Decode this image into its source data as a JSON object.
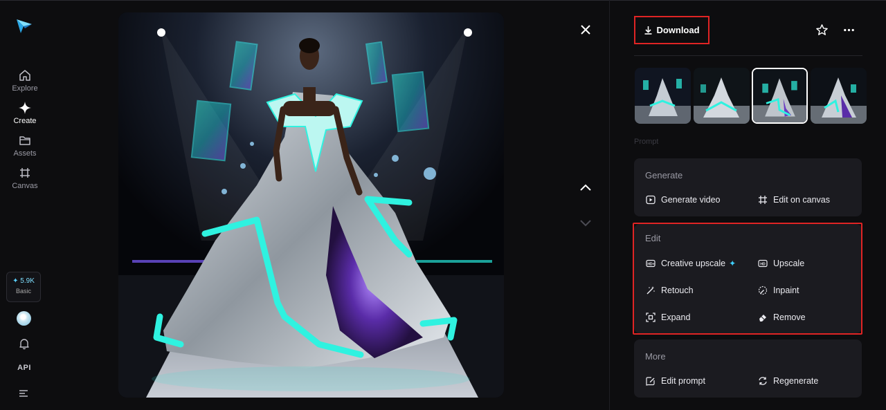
{
  "nav": {
    "items": [
      {
        "label": "Explore",
        "icon": "home-icon"
      },
      {
        "label": "Create",
        "icon": "sparkle-icon",
        "active": true
      },
      {
        "label": "Assets",
        "icon": "folder-icon"
      },
      {
        "label": "Canvas",
        "icon": "canvas-icon"
      }
    ],
    "credits": {
      "amount": "5.9K",
      "plan": "Basic"
    },
    "api_label": "API"
  },
  "panel": {
    "download_label": "Download",
    "prompt_label": "Prompt",
    "generate": {
      "title": "Generate",
      "actions": [
        {
          "label": "Generate video",
          "icon": "play-icon"
        },
        {
          "label": "Edit on canvas",
          "icon": "canvas-icon"
        }
      ]
    },
    "edit": {
      "title": "Edit",
      "actions": [
        {
          "label": "Creative upscale",
          "icon": "hd-plus-icon"
        },
        {
          "label": "Upscale",
          "icon": "hd-icon"
        },
        {
          "label": "Retouch",
          "icon": "magic-wand-icon"
        },
        {
          "label": "Inpaint",
          "icon": "brush-circle-icon"
        },
        {
          "label": "Expand",
          "icon": "expand-icon"
        },
        {
          "label": "Remove",
          "icon": "eraser-icon"
        }
      ]
    },
    "more": {
      "title": "More",
      "actions": [
        {
          "label": "Edit prompt",
          "icon": "edit-prompt-icon"
        },
        {
          "label": "Regenerate",
          "icon": "regenerate-icon"
        }
      ]
    }
  },
  "thumbnails": {
    "count": 4,
    "selected_index": 2
  },
  "colors": {
    "accent": "#3fd0ff",
    "highlight": "#e02424",
    "background": "#0d0d0f",
    "card": "#1b1b20"
  }
}
